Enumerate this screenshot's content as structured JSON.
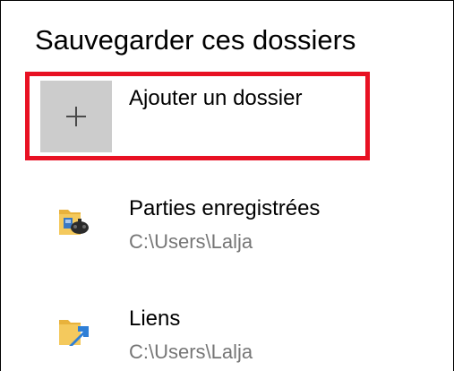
{
  "section": {
    "title": "Sauvegarder ces dossiers"
  },
  "add_folder": {
    "label": "Ajouter un dossier",
    "icon": "plus-icon"
  },
  "folders": [
    {
      "name": "Parties enregistrées",
      "path": "C:\\Users\\Lalja",
      "icon": "saved-games-folder-icon"
    },
    {
      "name": "Liens",
      "path": "C:\\Users\\Lalja",
      "icon": "links-folder-icon"
    }
  ],
  "colors": {
    "highlight": "#e81123",
    "tile_background": "#cccccc",
    "secondary_text": "#767676",
    "folder_yellow": "#f4c95d"
  }
}
